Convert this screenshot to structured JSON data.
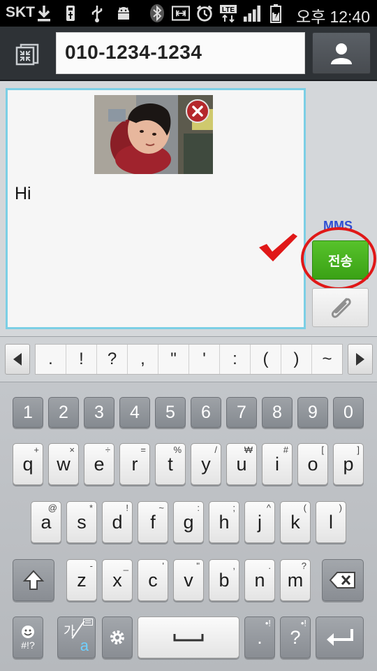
{
  "status_bar": {
    "carrier": "SKT",
    "ampm": "오후",
    "time": "12:40",
    "network": "LTE",
    "icons": [
      "download-icon",
      "usb-icon",
      "usb-debug-icon",
      "android-debug-icon",
      "bluetooth-icon",
      "nfc-icon",
      "alarm-icon",
      "lte-icon",
      "signal-icon",
      "battery-charging-icon"
    ]
  },
  "header": {
    "recipient": "010-1234-1234"
  },
  "compose": {
    "message": "Hi",
    "mms_label": "MMS",
    "send_label": "전송"
  },
  "symbol_row": {
    "symbols": [
      ".",
      "!",
      "?",
      ",",
      "\"",
      "'",
      ":",
      "(",
      ")",
      "~"
    ]
  },
  "keyboard": {
    "numbers": [
      "1",
      "2",
      "3",
      "4",
      "5",
      "6",
      "7",
      "8",
      "9",
      "0"
    ],
    "row1": [
      {
        "main": "q",
        "sub": "+"
      },
      {
        "main": "w",
        "sub": "×"
      },
      {
        "main": "e",
        "sub": "÷"
      },
      {
        "main": "r",
        "sub": "="
      },
      {
        "main": "t",
        "sub": "%"
      },
      {
        "main": "y",
        "sub": "/"
      },
      {
        "main": "u",
        "sub": "₩"
      },
      {
        "main": "i",
        "sub": "#"
      },
      {
        "main": "o",
        "sub": "["
      },
      {
        "main": "p",
        "sub": "]"
      }
    ],
    "row2": [
      {
        "main": "a",
        "sub": "@"
      },
      {
        "main": "s",
        "sub": "*"
      },
      {
        "main": "d",
        "sub": "!"
      },
      {
        "main": "f",
        "sub": "~"
      },
      {
        "main": "g",
        "sub": ":"
      },
      {
        "main": "h",
        "sub": ";"
      },
      {
        "main": "j",
        "sub": "^"
      },
      {
        "main": "k",
        "sub": "("
      },
      {
        "main": "l",
        "sub": ")"
      }
    ],
    "row3": [
      {
        "main": "z",
        "sub": "-"
      },
      {
        "main": "x",
        "sub": "_"
      },
      {
        "main": "c",
        "sub": "'"
      },
      {
        "main": "v",
        "sub": "\""
      },
      {
        "main": "b",
        "sub": ","
      },
      {
        "main": "n",
        "sub": "."
      },
      {
        "main": "m",
        "sub": "?"
      }
    ],
    "emoji_sub": "#!?",
    "lang_top": "가",
    "lang_bottom": "a",
    "period": ".",
    "question": "?",
    "period_sub": "•!",
    "question_sub": "•!"
  },
  "colors": {
    "accent_border": "#7ccfe5",
    "send_green": "#3aa115",
    "annotation_red": "#e01818",
    "mms_blue": "#2f4fd3"
  }
}
